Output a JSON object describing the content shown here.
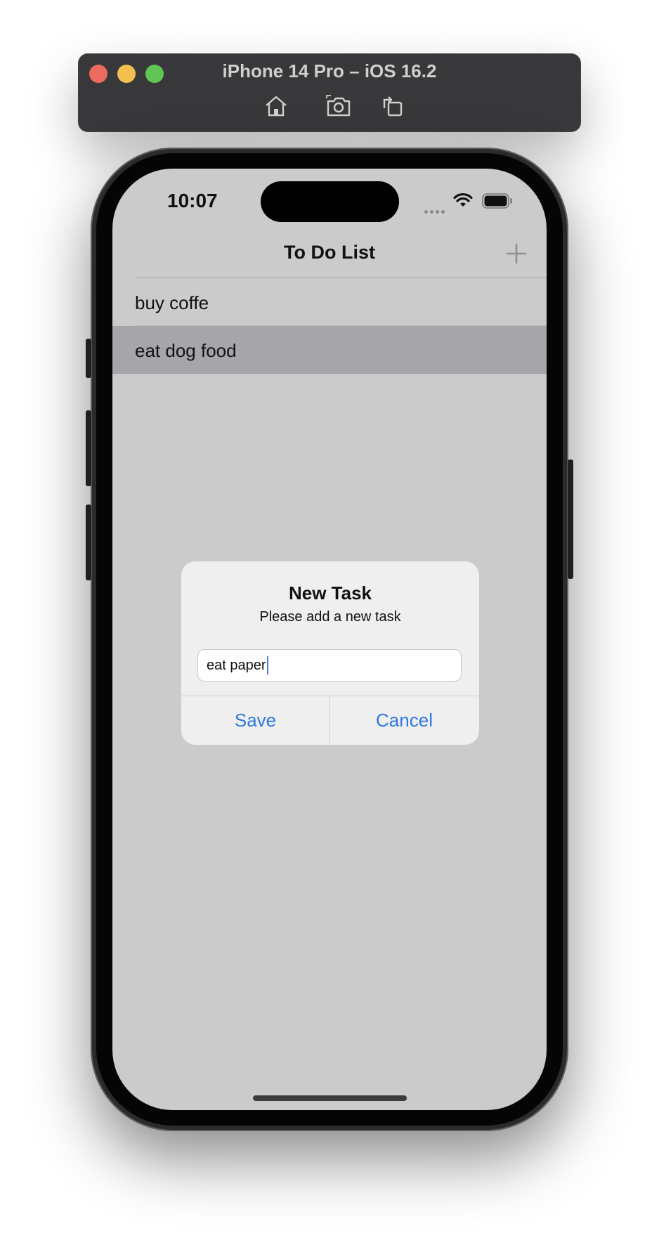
{
  "simulator": {
    "title": "iPhone 14 Pro – iOS 16.2",
    "tools": [
      "home-icon",
      "screenshot-icon",
      "rotate-icon"
    ]
  },
  "status_bar": {
    "time": "10:07"
  },
  "nav": {
    "title": "To Do List",
    "add_icon": "plus-icon"
  },
  "tasks": [
    {
      "label": "buy coffe",
      "selected": false
    },
    {
      "label": "eat dog food",
      "selected": true
    }
  ],
  "alert": {
    "title": "New Task",
    "message": "Please add a new task",
    "field_value": "eat paper",
    "save_label": "Save",
    "cancel_label": "Cancel"
  },
  "colors": {
    "accent": "#2f78e0",
    "screen_dim": "#cbcbcb",
    "row_selected": "#a6a5aa"
  }
}
